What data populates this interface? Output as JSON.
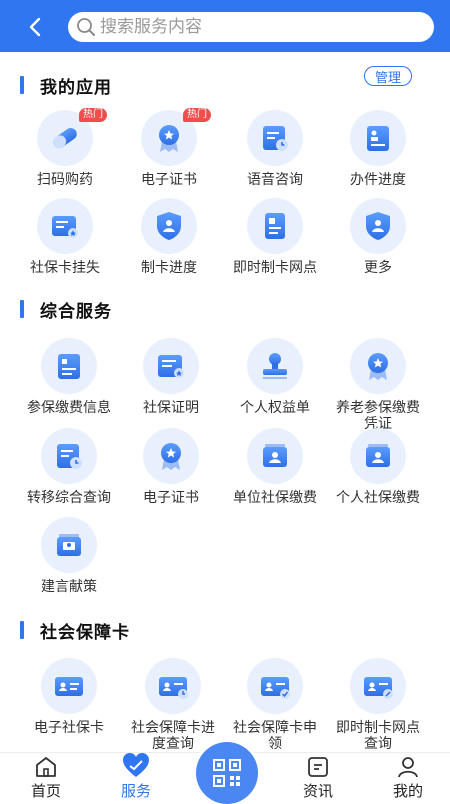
{
  "header": {
    "search_placeholder": "搜索服务内容"
  },
  "my_apps": {
    "title": "我的应用",
    "manage_label": "管理",
    "items": [
      {
        "label": "扫码购药",
        "icon": "pill-icon",
        "badge": "热门"
      },
      {
        "label": "电子证书",
        "icon": "certificate-icon",
        "badge": "热门"
      },
      {
        "label": "语音咨询",
        "icon": "voice-consult-icon"
      },
      {
        "label": "办件进度",
        "icon": "progress-doc-icon"
      },
      {
        "label": "社保卡挂失",
        "icon": "card-loss-icon"
      },
      {
        "label": "制卡进度",
        "icon": "card-progress-icon"
      },
      {
        "label": "即时制卡网点",
        "icon": "instant-card-icon"
      },
      {
        "label": "更多",
        "icon": "more-icon"
      }
    ]
  },
  "services": {
    "title": "综合服务",
    "items": [
      {
        "label": "参保缴费信息",
        "icon": "payment-info-icon"
      },
      {
        "label": "社保证明",
        "icon": "proof-icon"
      },
      {
        "label": "个人权益单",
        "icon": "stamp-icon"
      },
      {
        "label": "养老参保缴费凭证",
        "label2": "凭证",
        "label1": "养老参保缴费",
        "icon": "pension-icon"
      },
      {
        "label": "转移综合查询",
        "icon": "transfer-icon"
      },
      {
        "label": "电子证书",
        "icon": "certificate-icon"
      },
      {
        "label": "单位社保缴费",
        "icon": "unit-pay-icon"
      },
      {
        "label": "个人社保缴费",
        "icon": "personal-pay-icon"
      },
      {
        "label": "建言献策",
        "icon": "suggestion-icon"
      }
    ]
  },
  "card": {
    "title": "社会保障卡",
    "items": [
      {
        "label1": "电子社保卡",
        "label2": "",
        "icon": "e-card-icon"
      },
      {
        "label1": "社会保障卡进度",
        "label2": "度查询",
        "icon": "card-query-icon"
      },
      {
        "label1": "社会保障卡申",
        "label2": "领",
        "icon": "card-apply-icon"
      },
      {
        "label1": "即时制卡网点",
        "label2": "查询",
        "icon": "instant-point-icon"
      }
    ]
  },
  "tabbar": {
    "home": "首页",
    "service": "服务",
    "news": "资讯",
    "mine": "我的"
  },
  "colors": {
    "primary": "#2f76f0",
    "icon_bg": "#e9f0fd",
    "hot": "#f24d4d"
  }
}
